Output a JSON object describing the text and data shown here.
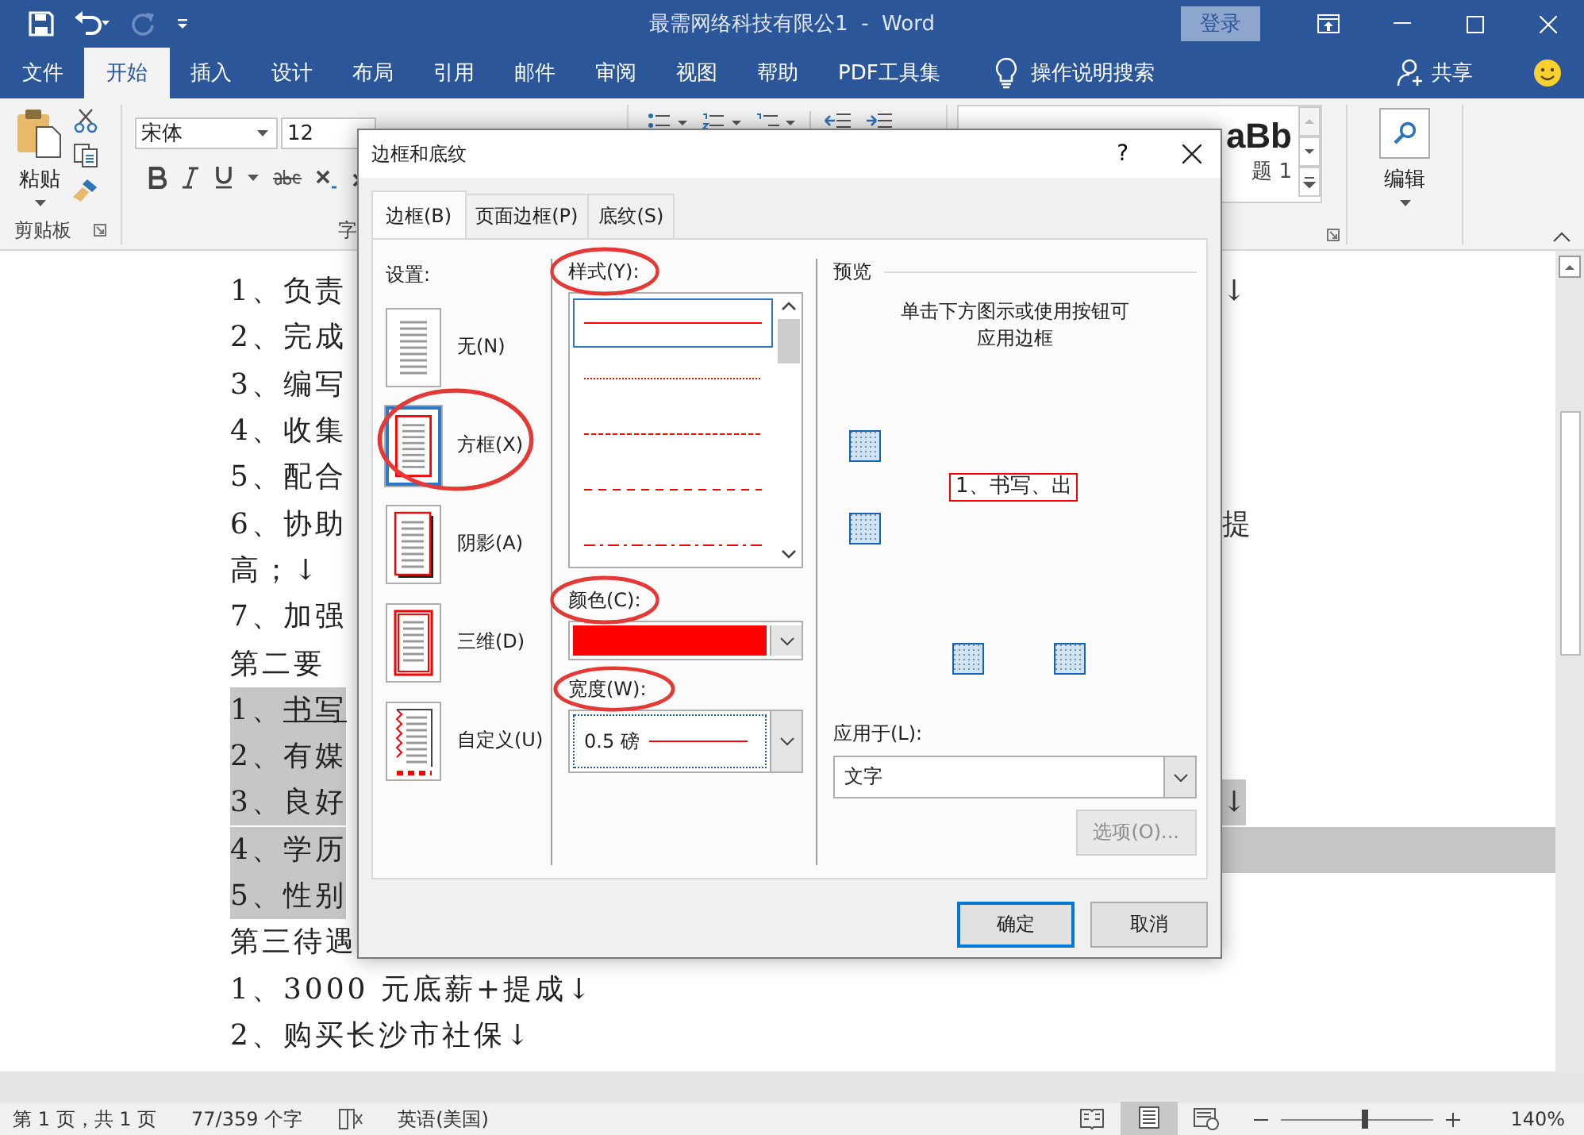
{
  "window": {
    "title": "最需网络科技有限公1  -  Word",
    "login": "登录"
  },
  "ribbon_tabs": [
    {
      "label": "文件",
      "selected": false
    },
    {
      "label": "开始",
      "selected": true
    },
    {
      "label": "插入",
      "selected": false
    },
    {
      "label": "设计",
      "selected": false
    },
    {
      "label": "布局",
      "selected": false
    },
    {
      "label": "引用",
      "selected": false
    },
    {
      "label": "邮件",
      "selected": false
    },
    {
      "label": "审阅",
      "selected": false
    },
    {
      "label": "视图",
      "selected": false
    },
    {
      "label": "帮助",
      "selected": false
    },
    {
      "label": "PDF工具集",
      "selected": false
    }
  ],
  "tell_me": "操作说明搜索",
  "share": "共享",
  "clipboard": {
    "paste": "粘贴",
    "group": "剪贴板"
  },
  "font": {
    "name": "宋体",
    "size": "12",
    "group": "字"
  },
  "styles": {
    "sample": "aBb",
    "caption": "题 1"
  },
  "editing": {
    "label": "编辑"
  },
  "document": {
    "lines": [
      {
        "marker": "1、",
        "text": "负责",
        "right": "↓",
        "selected": false,
        "underlined": false,
        "selection_continues": false
      },
      {
        "marker": "2、",
        "text": "完成",
        "selected": false,
        "underlined": false,
        "selection_continues": false
      },
      {
        "marker": "3、",
        "text": "编写",
        "selected": false,
        "underlined": false,
        "selection_continues": false
      },
      {
        "marker": "4、",
        "text": "收集",
        "selected": false,
        "underlined": false,
        "selection_continues": false
      },
      {
        "marker": "5、",
        "text": "配合",
        "selected": false,
        "underlined": false,
        "selection_continues": false
      },
      {
        "marker": "6、",
        "text": "协助",
        "right": "提",
        "selected": false,
        "underlined": false,
        "selection_continues": false
      },
      {
        "text": "高；↓",
        "selected": false,
        "underlined": false,
        "selection_continues": false
      },
      {
        "marker": "7、",
        "text": "加强",
        "selected": false,
        "underlined": false,
        "selection_continues": false
      },
      {
        "text": "第二要",
        "selected": false,
        "underlined": false,
        "selection_continues": false
      },
      {
        "marker": "1、",
        "text": "书写",
        "selected": true,
        "underlined": true,
        "selection_continues": false
      },
      {
        "marker": "2、",
        "text": "有媒",
        "selected": true,
        "underlined": false,
        "selection_continues": false
      },
      {
        "marker": "3、",
        "text": "良好",
        "right": "↓",
        "selected": true,
        "underlined": false,
        "selection_continues": false
      },
      {
        "marker": "4、",
        "text": "学历",
        "selected": true,
        "underlined": false,
        "selection_continues": true
      },
      {
        "marker": "5、",
        "text": "性别",
        "selected": true,
        "underlined": false,
        "selection_continues": false
      },
      {
        "text": "第三待遇",
        "selected": false,
        "underlined": false,
        "selection_continues": false
      },
      {
        "marker": "1、",
        "text": "3000 元底薪+提成↓",
        "selected": false,
        "underlined": false,
        "selection_continues": false
      },
      {
        "marker": "2、",
        "text": "购买长沙市社保↓",
        "selected": false,
        "underlined": false,
        "selection_continues": false
      }
    ]
  },
  "dialog": {
    "title": "边框和底纹",
    "help": "?",
    "tabs": [
      {
        "label": "边框(B)",
        "selected": true
      },
      {
        "label": "页面边框(P)",
        "selected": false
      },
      {
        "label": "底纹(S)",
        "selected": false
      }
    ],
    "settings": {
      "label": "设置:",
      "items": [
        {
          "kind": "none",
          "label": "无(N)",
          "selected": false,
          "circled": false
        },
        {
          "kind": "box",
          "label": "方框(X)",
          "selected": true,
          "circled": true
        },
        {
          "kind": "shadow",
          "label": "阴影(A)",
          "selected": false,
          "circled": false
        },
        {
          "kind": "raised",
          "label": "三维(D)",
          "selected": false,
          "circled": false
        },
        {
          "kind": "custom",
          "label": "自定义(U)",
          "selected": false,
          "circled": false
        }
      ]
    },
    "style": {
      "label": "样式(Y):",
      "circled": true,
      "items": [
        {
          "kind": "solid",
          "selected": true
        },
        {
          "kind": "dotted",
          "selected": false
        },
        {
          "kind": "fine-dash",
          "selected": false
        },
        {
          "kind": "dash",
          "selected": false
        },
        {
          "kind": "dash-dot",
          "selected": false
        }
      ]
    },
    "color": {
      "label": "颜色(C):",
      "circled": true,
      "color": "#ff0000"
    },
    "width": {
      "label": "宽度(W):",
      "circled": true,
      "value": "0.5 磅"
    },
    "preview": {
      "label": "预览",
      "hint": [
        "单击下方图示或使用按钮可",
        "应用边框"
      ],
      "sample": "1、书写、出"
    },
    "apply_to": {
      "label": "应用于(L):",
      "value": "文字"
    },
    "options": {
      "label": "选项(O)...",
      "disabled": true
    },
    "buttons": [
      {
        "label": "确定",
        "default": true
      },
      {
        "label": "取消",
        "default": false
      }
    ]
  },
  "status_bar": {
    "page": "第 1 页，共 1 页",
    "words": "77/359 个字",
    "language": "英语(美国)",
    "zoom": "140%",
    "zoom_slider": {
      "level": 0.56
    }
  }
}
